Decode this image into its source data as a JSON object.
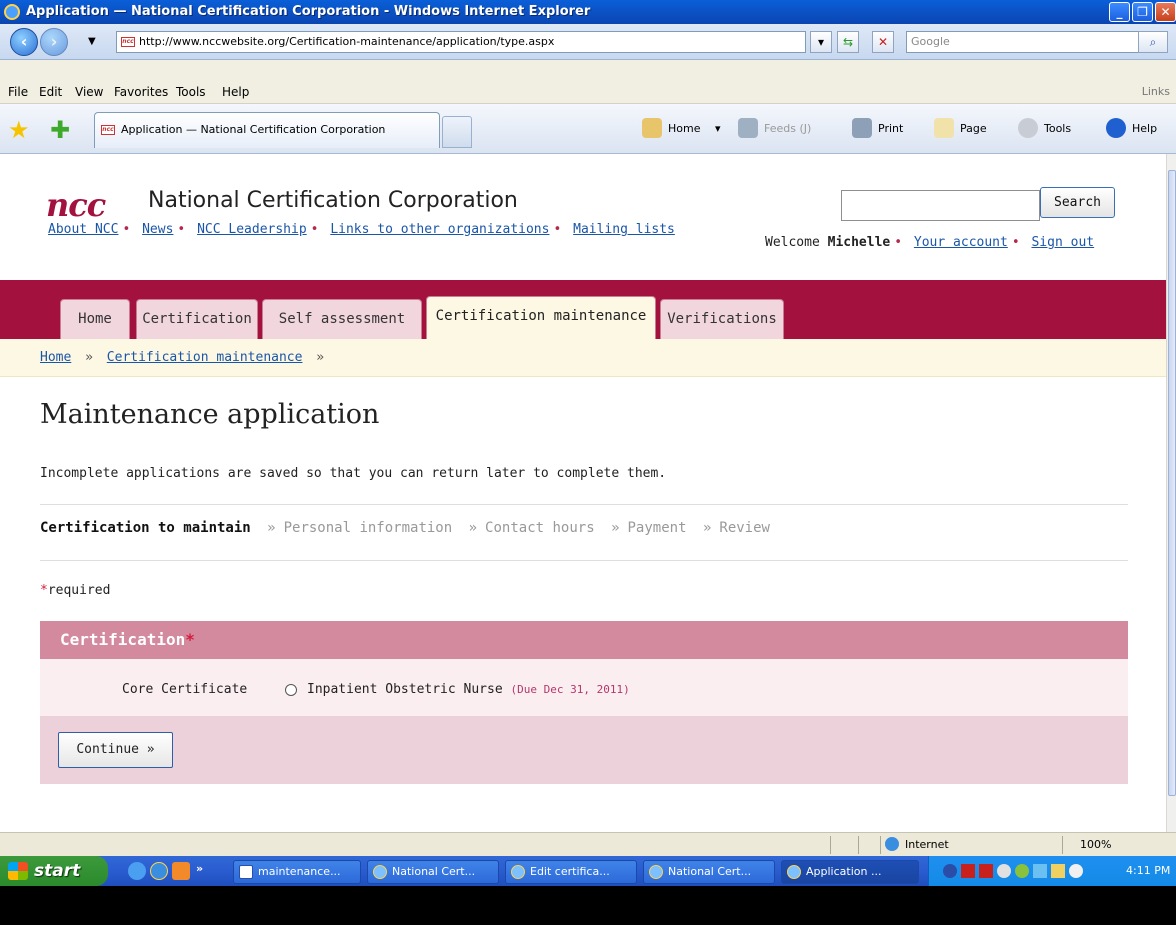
{
  "window": {
    "title": "Application — National Certification Corporation - Windows Internet Explorer"
  },
  "addressbar": {
    "url": "http://www.nccwebsite.org/Certification-maintenance/application/type.aspx",
    "search_placeholder": "Google"
  },
  "menubar": {
    "items": [
      "File",
      "Edit",
      "View",
      "Favorites",
      "Tools",
      "Help"
    ],
    "links_label": "Links"
  },
  "tabbar": {
    "active_tab": "Application — National Certification Corporation",
    "commands": {
      "home": "Home",
      "feeds": "Feeds (J)",
      "print": "Print",
      "page": "Page",
      "tools": "Tools",
      "help": "Help"
    }
  },
  "site": {
    "logo": "ncc",
    "org_name": "National Certification Corporation",
    "top_links": [
      "About NCC",
      "News",
      "NCC Leadership",
      "Links to other organizations",
      "Mailing lists"
    ],
    "search_button": "Search",
    "welcome_prefix": "Welcome",
    "user_name": "Michelle",
    "account_link": "Your account",
    "signout_link": "Sign out",
    "nav_tabs": [
      "Home",
      "Certification",
      "Self assessment",
      "Certification maintenance",
      "Verifications"
    ],
    "active_nav_tab": "Certification maintenance",
    "breadcrumb": [
      "Home",
      "Certification maintenance"
    ]
  },
  "main": {
    "heading": "Maintenance application",
    "intro": "Incomplete applications are saved so that you can return later to complete them.",
    "steps": [
      "Certification to maintain",
      "Personal information",
      "Contact hours",
      "Payment",
      "Review"
    ],
    "current_step": "Certification to maintain",
    "required_note": "required",
    "section_title": "Certification",
    "core_label": "Core Certificate",
    "option_label": "Inpatient Obstetric Nurse",
    "option_due": "(Due Dec 31, 2011)",
    "continue_button": "Continue »"
  },
  "statusbar": {
    "zone": "Internet",
    "zoom": "100%"
  },
  "taskbar": {
    "start_label": "start",
    "items": [
      "maintenance...",
      "National Cert...",
      "Edit certifica...",
      "National Cert...",
      "Application ..."
    ],
    "active_item": "Application ...",
    "clock": "4:11 PM"
  },
  "colors": {
    "brand": "#a3123f",
    "section_header": "#d3899e",
    "link": "#1a56a8"
  }
}
